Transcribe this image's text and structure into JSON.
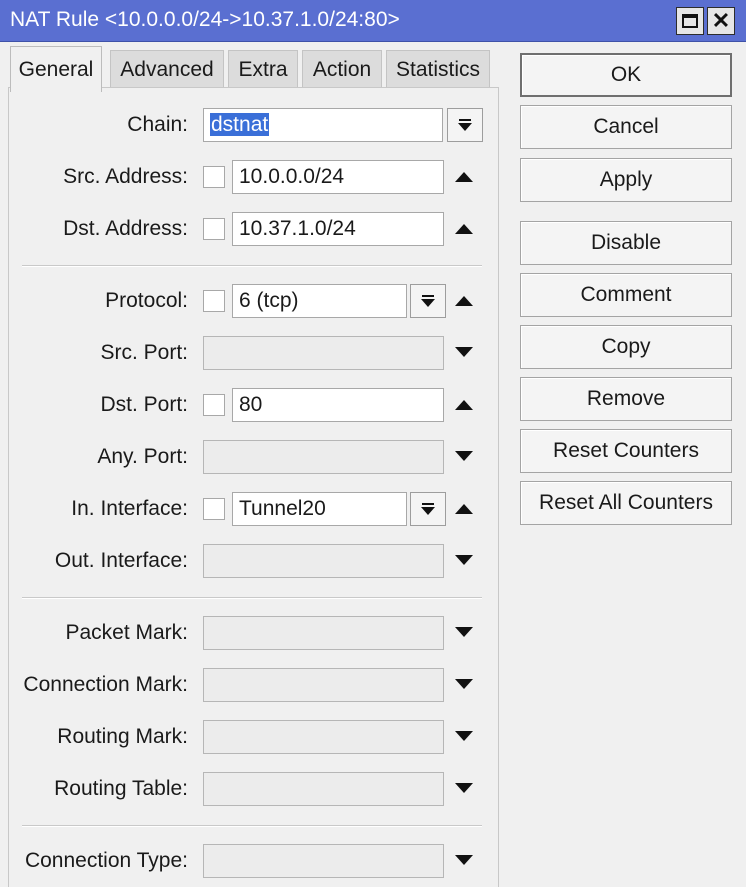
{
  "window": {
    "title": "NAT Rule <10.0.0.0/24->10.37.1.0/24:80>",
    "maximize_icon": "maximize-icon",
    "close_icon": "close-icon",
    "close_glyph": "✕"
  },
  "tabs": [
    "General",
    "Advanced",
    "Extra",
    "Action",
    "Statistics"
  ],
  "active_tab": "General",
  "form": {
    "chain": {
      "label": "Chain:",
      "value": "dstnat"
    },
    "src_address": {
      "label": "Src. Address:",
      "value": "10.0.0.0/24"
    },
    "dst_address": {
      "label": "Dst. Address:",
      "value": "10.37.1.0/24"
    },
    "protocol": {
      "label": "Protocol:",
      "value": "6 (tcp)"
    },
    "src_port": {
      "label": "Src. Port:",
      "value": ""
    },
    "dst_port": {
      "label": "Dst. Port:",
      "value": "80"
    },
    "any_port": {
      "label": "Any. Port:",
      "value": ""
    },
    "in_interface": {
      "label": "In. Interface:",
      "value": "Tunnel20"
    },
    "out_interface": {
      "label": "Out. Interface:",
      "value": ""
    },
    "packet_mark": {
      "label": "Packet Mark:",
      "value": ""
    },
    "connection_mark": {
      "label": "Connection Mark:",
      "value": ""
    },
    "routing_mark": {
      "label": "Routing Mark:",
      "value": ""
    },
    "routing_table": {
      "label": "Routing Table:",
      "value": ""
    },
    "connection_type": {
      "label": "Connection Type:",
      "value": ""
    }
  },
  "buttons": {
    "ok": "OK",
    "cancel": "Cancel",
    "apply": "Apply",
    "disable": "Disable",
    "comment": "Comment",
    "copy": "Copy",
    "remove": "Remove",
    "reset_counters": "Reset Counters",
    "reset_all_counters": "Reset All Counters"
  },
  "colors": {
    "titlebar": "#5a6fd1",
    "selection": "#3a6fd8",
    "background": "#f0f0f0"
  }
}
